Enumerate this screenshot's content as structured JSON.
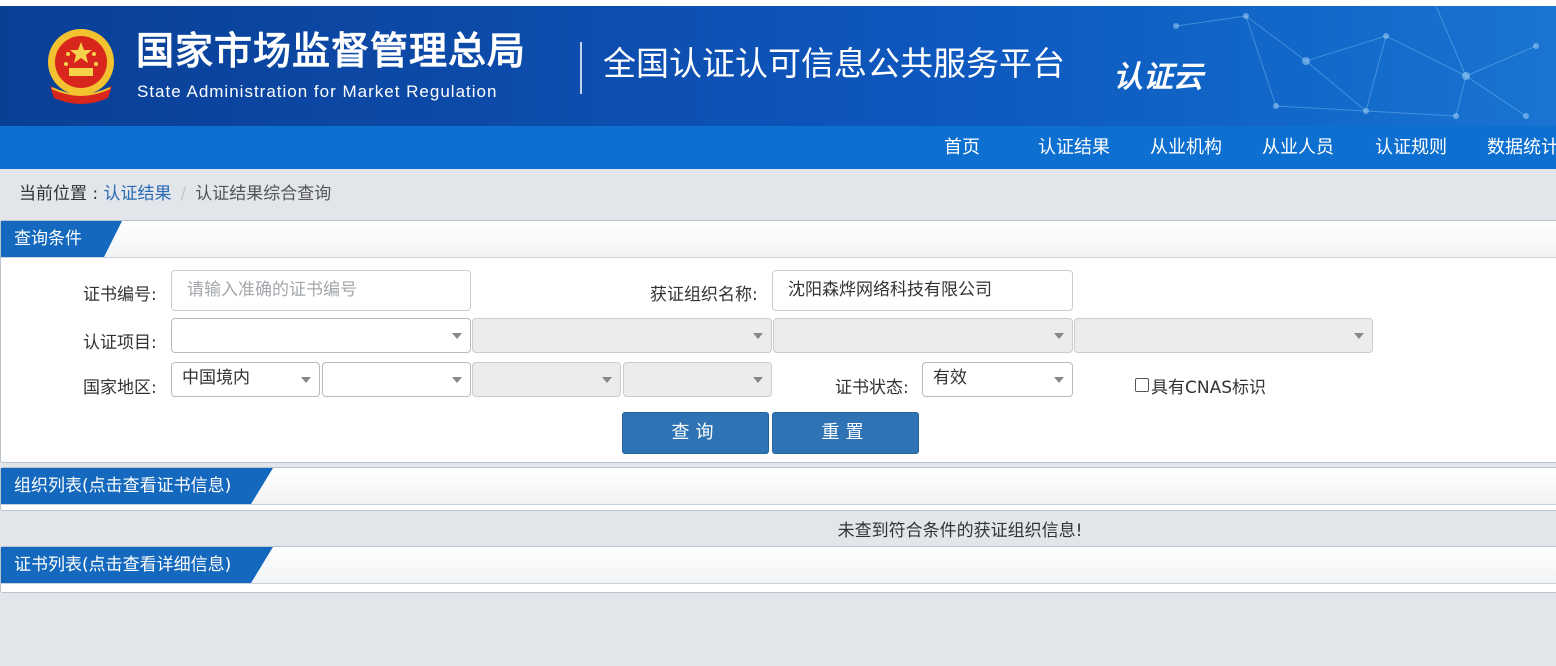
{
  "header": {
    "org_name_cn": "国家市场监督管理总局",
    "org_name_en": "State Administration  for  Market Regulation",
    "platform_title": "全国认证认可信息公共服务平台",
    "platform_logo_text": "认证云"
  },
  "nav": {
    "items": [
      "首页",
      "认证结果",
      "从业机构",
      "从业人员",
      "认证规则",
      "数据统计"
    ]
  },
  "breadcrumb": {
    "prefix": "当前位置 : ",
    "link": "认证结果",
    "separator": "/",
    "current": "认证结果综合查询"
  },
  "query_panel": {
    "title": "查询条件",
    "cert_no_label": "证书编号:",
    "cert_no_placeholder": "请输入准确的证书编号",
    "org_name_label": "获证组织名称:",
    "org_name_value": "沈阳森烨网络科技有限公司",
    "project_label": "认证项目:",
    "project_selects": [
      "",
      "",
      "",
      ""
    ],
    "region_label": "国家地区:",
    "region_selects": [
      "中国境内",
      "",
      "",
      ""
    ],
    "status_label": "证书状态:",
    "status_value": "有效",
    "cnas_label": "具有CNAS标识",
    "search_button": "查询",
    "reset_button": "重置"
  },
  "org_panel": {
    "title": "组织列表(点击查看证书信息)",
    "empty_message": "未查到符合条件的获证组织信息!"
  },
  "cert_panel": {
    "title": "证书列表(点击查看详细信息)"
  },
  "colors": {
    "banner": "#0c4aa8",
    "navbar": "#0d6fd0",
    "tab": "#1468bd",
    "button": "#2e74b5",
    "background": "#e2e6ea"
  }
}
